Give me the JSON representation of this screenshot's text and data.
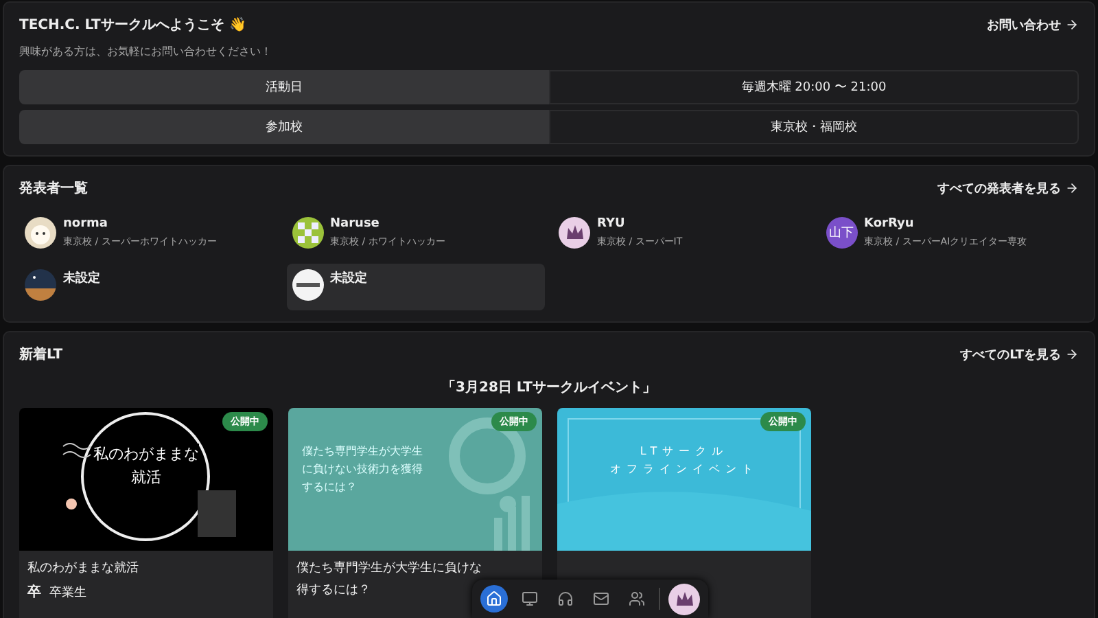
{
  "welcome": {
    "title": "TECH.C. LTサークルへようこそ",
    "emoji": "👋",
    "subtitle": "興味がある方は、お気軽にお問い合わせください！",
    "link": "お問い合わせ",
    "rows": [
      {
        "label": "活動日",
        "value": "毎週木曜 20:00 〜 21:00"
      },
      {
        "label": "参加校",
        "value": "東京校・福岡校"
      }
    ]
  },
  "presenters": {
    "title": "発表者一覧",
    "link": "すべての発表者を見る",
    "items": [
      {
        "name": "norma",
        "detail": "東京校 / スーパーホワイトハッカー",
        "selected": false
      },
      {
        "name": "Naruse",
        "detail": "東京校 / ホワイトハッカー",
        "selected": false
      },
      {
        "name": "RYU",
        "detail": "東京校 / スーパーIT",
        "selected": false
      },
      {
        "name": "KorRyu",
        "detail": "東京校 / スーパーAIクリエイター専攻",
        "initials": "山下",
        "selected": false
      },
      {
        "name": "未設定",
        "selected": false
      },
      {
        "name": "未設定",
        "selected": true
      }
    ]
  },
  "new_lt": {
    "title": "新着LT",
    "link": "すべてのLTを見る",
    "event": "「3月28日 LTサークルイベント」",
    "cards": [
      {
        "slide_lines": [
          "私のわがままな",
          "就活"
        ],
        "badge": "公開中",
        "title_lines": [
          "私のわがままな就活"
        ],
        "author_initial": "卒",
        "author": "卒業生"
      },
      {
        "slide_lines": [
          "僕たち専門学生が大学生",
          "に負けない技術力を獲得",
          "するには？"
        ],
        "badge": "公開中",
        "title_lines": [
          "僕たち専門学生が大学生に負けな",
          "得するには？"
        ]
      },
      {
        "slide_lines": [
          "LTサークル",
          "オフラインイベント"
        ],
        "badge": "公開中"
      }
    ]
  },
  "dock": {
    "items": [
      {
        "selected": true
      },
      {
        "selected": false
      },
      {
        "selected": false
      },
      {
        "selected": false
      },
      {
        "selected": false
      }
    ]
  }
}
